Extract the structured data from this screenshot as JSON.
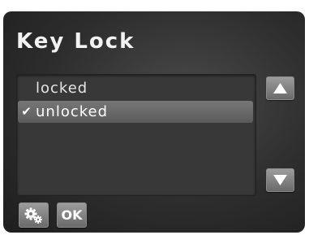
{
  "title": "Key Lock",
  "options": [
    {
      "label": "locked",
      "selected": false,
      "check": ""
    },
    {
      "label": "unlocked",
      "selected": true,
      "check": "✔"
    }
  ],
  "buttons": {
    "scroll_up_icon": "triangle-up-icon",
    "scroll_down_icon": "triangle-down-icon",
    "settings_icon": "gears-icon",
    "ok_label": "OK"
  },
  "colors": {
    "background": "#2d2d2d",
    "text": "#f2f2f2",
    "selection": "#6a6a6a",
    "button": "#8a8a8a"
  }
}
